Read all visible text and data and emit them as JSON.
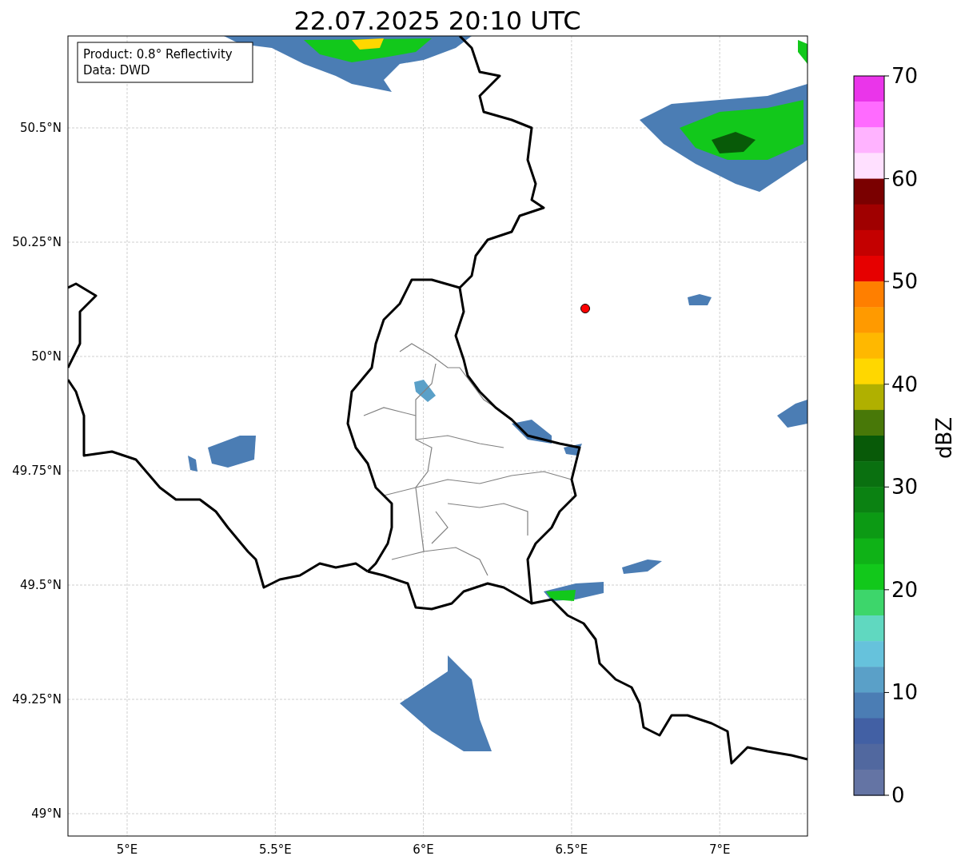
{
  "title": "22.07.2025 20:10 UTC",
  "info_box": [
    "Product: 0.8° Reflectivity",
    "Data: DWD"
  ],
  "map": {
    "lat_labels": [
      "50.5°N",
      "50.25°N",
      "50°N",
      "49.75°N",
      "49.5°N",
      "49.25°N",
      "49°N"
    ],
    "lon_labels": [
      "5°E",
      "5.5°E",
      "6°E",
      "6.5°E",
      "7°E"
    ]
  },
  "colorbar": {
    "label": "dBZ",
    "ticks": [
      "70",
      "60",
      "50",
      "40",
      "30",
      "20",
      "10",
      "0"
    ],
    "segments": [
      {
        "color": "#ea35ea"
      },
      {
        "color": "#ff6bff"
      },
      {
        "color": "#ffb3ff"
      },
      {
        "color": "#ffe0ff"
      },
      {
        "color": "#7a0000"
      },
      {
        "color": "#a00000"
      },
      {
        "color": "#c40000"
      },
      {
        "color": "#e60000"
      },
      {
        "color": "#ff7f00"
      },
      {
        "color": "#ff9a00"
      },
      {
        "color": "#ffb800"
      },
      {
        "color": "#ffd700"
      },
      {
        "color": "#b0b000"
      },
      {
        "color": "#487808"
      },
      {
        "color": "#085a08"
      },
      {
        "color": "#0a7010"
      },
      {
        "color": "#0b8212"
      },
      {
        "color": "#0c9a14"
      },
      {
        "color": "#0fb217"
      },
      {
        "color": "#12c81b"
      },
      {
        "color": "#3dd66b"
      },
      {
        "color": "#60d8c0"
      },
      {
        "color": "#66c2dc"
      },
      {
        "color": "#5aa0c8"
      },
      {
        "color": "#4b7db4"
      },
      {
        "color": "#4260a4"
      },
      {
        "color": "#51689f"
      },
      {
        "color": "#6474a4"
      }
    ]
  }
}
